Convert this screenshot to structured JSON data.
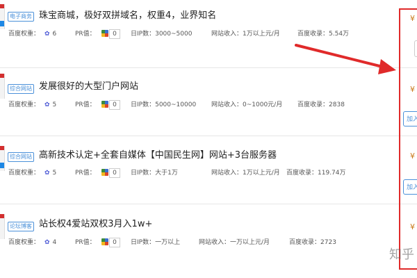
{
  "labels": {
    "baidu_weight": "百度权重：",
    "pr": "PR值：",
    "daily_ip": "日IP数：",
    "revenue": "网站收入：",
    "baidu_index": "百度收录："
  },
  "listings": [
    {
      "tag": "电子商务",
      "title": "珠宝商城，极好双拼域名，权重4，业界知名",
      "baidu_weight": "6",
      "pr": "0",
      "daily_ip": "3000~5000",
      "revenue": "1万以上元/月",
      "baidu_index": "5.54万",
      "price_icon": "¥"
    },
    {
      "tag": "综合网站",
      "title": "发展很好的大型门户网站",
      "baidu_weight": "5",
      "pr": "0",
      "daily_ip": "5000~10000",
      "revenue": "0~1000元/月",
      "baidu_index": "2838",
      "price_icon": "¥",
      "side_button": "加入"
    },
    {
      "tag": "综合网站",
      "title": "高新技术认定+全套自媒体【中国民生网】网站+3台服务器",
      "baidu_weight": "5",
      "pr": "0",
      "daily_ip": "大于1万",
      "revenue": "1万以上元/月",
      "baidu_index": "119.74万",
      "price_icon": "¥",
      "side_button": "加入"
    },
    {
      "tag": "论坛博客",
      "title": "站长权4爱站双权3月入1w+",
      "baidu_weight": "4",
      "pr": "0",
      "daily_ip": "一万以上",
      "revenue": "一万以上元/月",
      "baidu_index": "2723",
      "price_icon": "¥"
    }
  ],
  "watermark": "知乎",
  "colors": {
    "accent": "#4a90d9",
    "highlight_red": "#e02a2a",
    "price": "#c97a1a"
  }
}
